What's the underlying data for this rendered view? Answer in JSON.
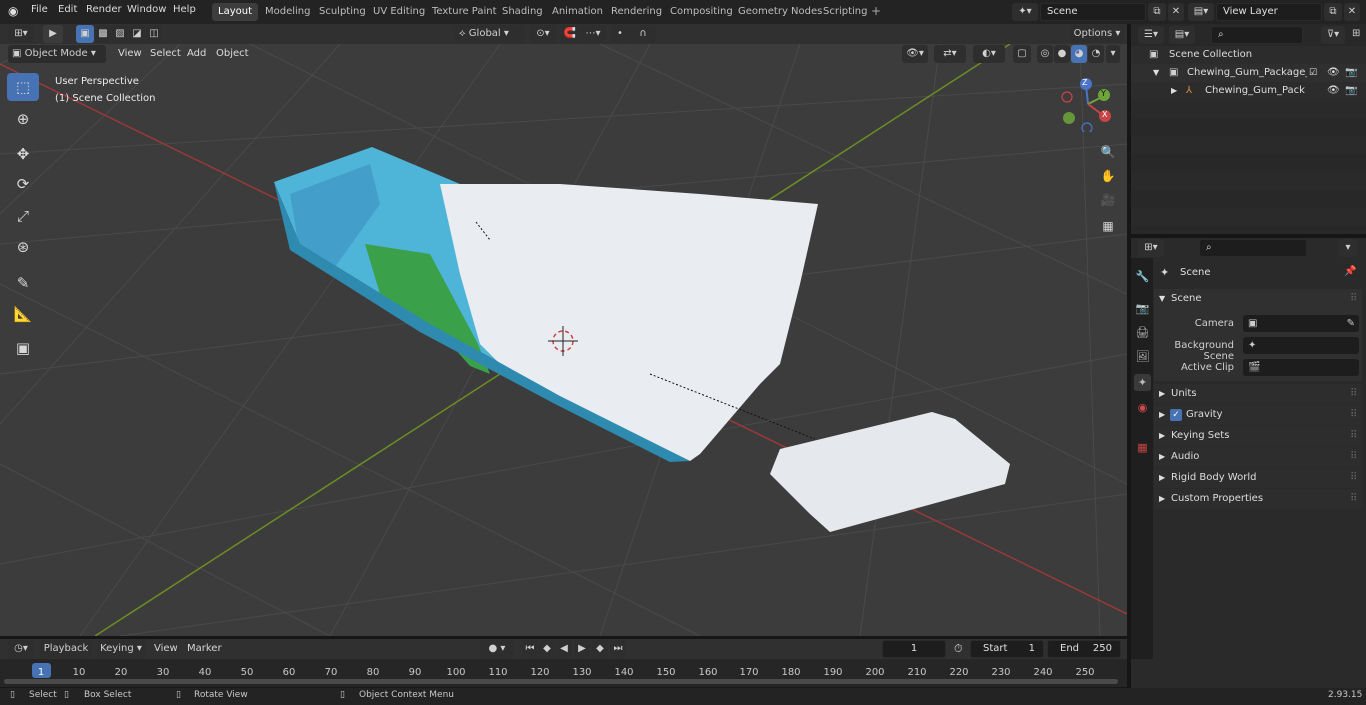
{
  "app": {
    "menus": [
      "File",
      "Edit",
      "Render",
      "Window",
      "Help"
    ],
    "workspaces": [
      "Layout",
      "Modeling",
      "Sculpting",
      "UV Editing",
      "Texture Paint",
      "Shading",
      "Animation",
      "Rendering",
      "Compositing",
      "Geometry Nodes",
      "Scripting"
    ],
    "active_workspace": "Layout",
    "add_workspace": "+",
    "scene_name": "Scene",
    "view_layer": "View Layer",
    "version": "2.93.15"
  },
  "viewport_header": {
    "mode": "Object Mode",
    "menus": [
      "View",
      "Select",
      "Add",
      "Object"
    ],
    "orientation": "Global",
    "options_label": "Options"
  },
  "viewport": {
    "perspective_label": "User Perspective",
    "collection_label": "(1) Scene Collection",
    "gizmo": {
      "z": "Z",
      "y": "Y",
      "x": "X"
    }
  },
  "outliner": {
    "root": "Scene Collection",
    "collection": "Chewing_Gum_Package_Ope",
    "object": "Chewing_Gum_Package_"
  },
  "properties": {
    "context": "Scene",
    "panel": "Scene",
    "fields": [
      {
        "label": "Camera",
        "value": ""
      },
      {
        "label": "Background Scene",
        "value": ""
      },
      {
        "label": "Active Clip",
        "value": ""
      }
    ],
    "subpanels": [
      "Units",
      "Gravity",
      "Keying Sets",
      "Audio",
      "Rigid Body World",
      "Custom Properties"
    ],
    "gravity_checked": true
  },
  "timeline": {
    "menus": [
      "Playback",
      "Keying",
      "View",
      "Marker"
    ],
    "current_frame": "1",
    "start_label": "Start",
    "start_value": "1",
    "end_label": "End",
    "end_value": "250",
    "ruler": [
      "1",
      "10",
      "20",
      "30",
      "40",
      "50",
      "60",
      "70",
      "80",
      "90",
      "100",
      "110",
      "120",
      "130",
      "140",
      "150",
      "160",
      "170",
      "180",
      "190",
      "200",
      "210",
      "220",
      "230",
      "240",
      "250"
    ]
  },
  "statusbar": {
    "select": "Select",
    "box_select": "Box Select",
    "rotate_view": "Rotate View",
    "context_menu": "Object Context Menu"
  },
  "colors": {
    "accent": "#4772b3",
    "x_axis": "#9a3838",
    "y_axis": "#6b8e23",
    "package_blue": "#4fb5d8",
    "package_green": "#3aa04a",
    "package_white": "#e9ecf0"
  }
}
